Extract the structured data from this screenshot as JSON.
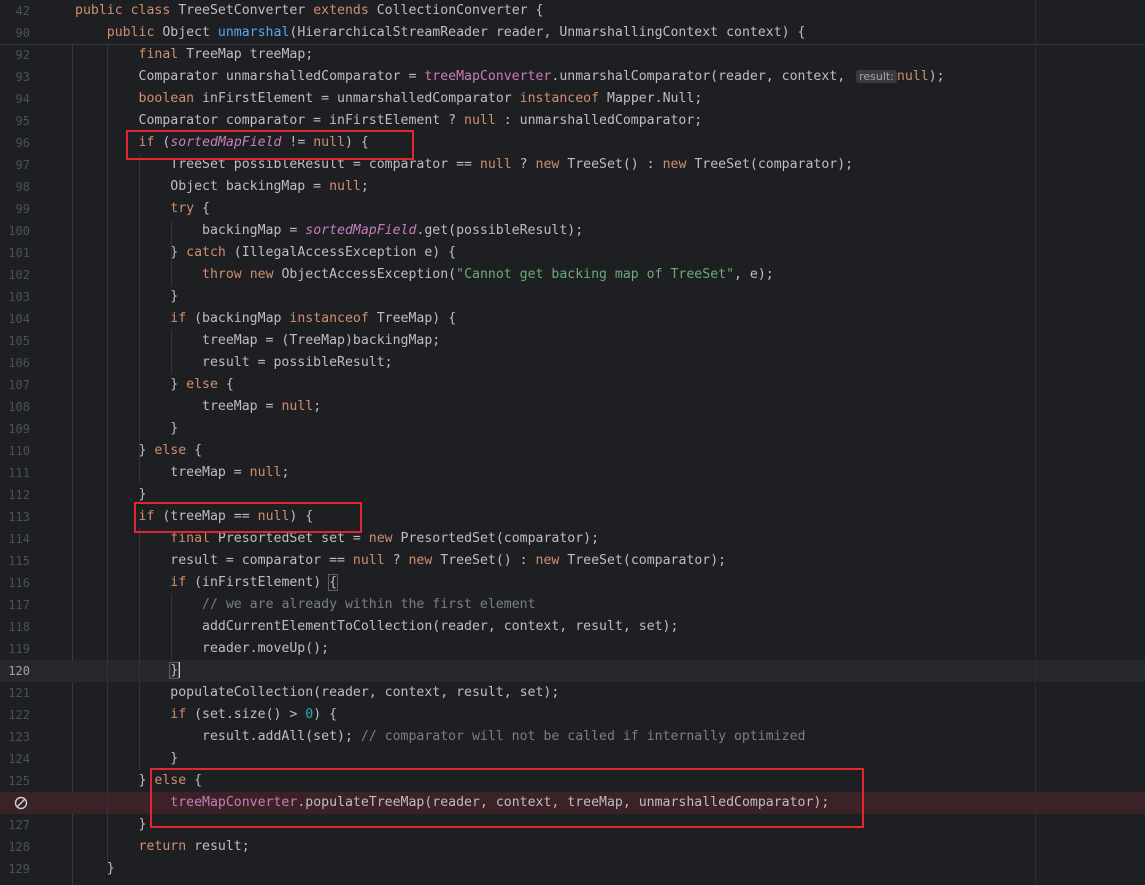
{
  "editor": {
    "sticky_lines": [
      {
        "ln": "42",
        "tokens": [
          {
            "t": "public ",
            "c": "k"
          },
          {
            "t": "class ",
            "c": "k"
          },
          {
            "t": "TreeSetConverter "
          },
          {
            "t": "extends ",
            "c": "k"
          },
          {
            "t": "CollectionConverter {"
          }
        ]
      },
      {
        "ln": "90",
        "tokens": [
          {
            "t": "    "
          },
          {
            "t": "public ",
            "c": "k"
          },
          {
            "t": "Object "
          },
          {
            "t": "unmarshal",
            "c": "fn"
          },
          {
            "t": "(HierarchicalStreamReader reader, UnmarshallingContext context) {"
          }
        ]
      }
    ],
    "lines": [
      {
        "ln": "92",
        "tokens": [
          {
            "t": "        "
          },
          {
            "t": "final ",
            "c": "k"
          },
          {
            "t": "TreeMap treeMap;"
          }
        ]
      },
      {
        "ln": "93",
        "tokens": [
          {
            "t": "        Comparator unmarshalledComparator = "
          },
          {
            "t": "treeMapConverter",
            "c": "fld"
          },
          {
            "t": ".unmarshalComparator(reader, context, "
          },
          {
            "t": "result:",
            "c": "hint"
          },
          {
            "t": "null",
            "c": "k"
          },
          {
            "t": ");"
          }
        ]
      },
      {
        "ln": "94",
        "tokens": [
          {
            "t": "        "
          },
          {
            "t": "boolean ",
            "c": "k"
          },
          {
            "t": "inFirstElement = unmarshalledComparator "
          },
          {
            "t": "instanceof ",
            "c": "k"
          },
          {
            "t": "Mapper.Null;"
          }
        ]
      },
      {
        "ln": "95",
        "tokens": [
          {
            "t": "        Comparator comparator = inFirstElement ? "
          },
          {
            "t": "null",
            "c": "k"
          },
          {
            "t": " : unmarshalledComparator;"
          }
        ]
      },
      {
        "ln": "96",
        "tokens": [
          {
            "t": "        "
          },
          {
            "t": "if ",
            "c": "k"
          },
          {
            "t": "("
          },
          {
            "t": "sortedMapField",
            "c": "fldi"
          },
          {
            "t": " != "
          },
          {
            "t": "null",
            "c": "k"
          },
          {
            "t": ") {"
          }
        ]
      },
      {
        "ln": "97",
        "tokens": [
          {
            "t": "            TreeSet possibleResult = comparator == "
          },
          {
            "t": "null",
            "c": "k"
          },
          {
            "t": " ? "
          },
          {
            "t": "new ",
            "c": "k"
          },
          {
            "t": "TreeSet() : "
          },
          {
            "t": "new ",
            "c": "k"
          },
          {
            "t": "TreeSet(comparator);"
          }
        ]
      },
      {
        "ln": "98",
        "tokens": [
          {
            "t": "            Object backingMap = "
          },
          {
            "t": "null",
            "c": "k"
          },
          {
            "t": ";"
          }
        ]
      },
      {
        "ln": "99",
        "tokens": [
          {
            "t": "            "
          },
          {
            "t": "try ",
            "c": "k"
          },
          {
            "t": "{"
          }
        ]
      },
      {
        "ln": "100",
        "tokens": [
          {
            "t": "                backingMap = "
          },
          {
            "t": "sortedMapField",
            "c": "fldi"
          },
          {
            "t": ".get(possibleResult);"
          }
        ]
      },
      {
        "ln": "101",
        "tokens": [
          {
            "t": "            } "
          },
          {
            "t": "catch ",
            "c": "k"
          },
          {
            "t": "(IllegalAccessException e) {"
          }
        ]
      },
      {
        "ln": "102",
        "tokens": [
          {
            "t": "                "
          },
          {
            "t": "throw ",
            "c": "k"
          },
          {
            "t": "new ",
            "c": "k"
          },
          {
            "t": "ObjectAccessException("
          },
          {
            "t": "\"Cannot get backing map of TreeSet\"",
            "c": "str"
          },
          {
            "t": ", e);"
          }
        ]
      },
      {
        "ln": "103",
        "tokens": [
          {
            "t": "            }"
          }
        ]
      },
      {
        "ln": "104",
        "tokens": [
          {
            "t": "            "
          },
          {
            "t": "if ",
            "c": "k"
          },
          {
            "t": "(backingMap "
          },
          {
            "t": "instanceof ",
            "c": "k"
          },
          {
            "t": "TreeMap) {"
          }
        ]
      },
      {
        "ln": "105",
        "tokens": [
          {
            "t": "                treeMap = (TreeMap)backingMap;"
          }
        ]
      },
      {
        "ln": "106",
        "tokens": [
          {
            "t": "                result = possibleResult;"
          }
        ]
      },
      {
        "ln": "107",
        "tokens": [
          {
            "t": "            } "
          },
          {
            "t": "else ",
            "c": "k"
          },
          {
            "t": "{"
          }
        ]
      },
      {
        "ln": "108",
        "tokens": [
          {
            "t": "                treeMap = "
          },
          {
            "t": "null",
            "c": "k"
          },
          {
            "t": ";"
          }
        ]
      },
      {
        "ln": "109",
        "tokens": [
          {
            "t": "            }"
          }
        ]
      },
      {
        "ln": "110",
        "tokens": [
          {
            "t": "        } "
          },
          {
            "t": "else ",
            "c": "k"
          },
          {
            "t": "{"
          }
        ]
      },
      {
        "ln": "111",
        "tokens": [
          {
            "t": "            treeMap = "
          },
          {
            "t": "null",
            "c": "k"
          },
          {
            "t": ";"
          }
        ]
      },
      {
        "ln": "112",
        "tokens": [
          {
            "t": "        }"
          }
        ]
      },
      {
        "ln": "113",
        "tokens": [
          {
            "t": "        "
          },
          {
            "t": "if ",
            "c": "k"
          },
          {
            "t": "(treeMap == "
          },
          {
            "t": "null",
            "c": "k"
          },
          {
            "t": ") {"
          }
        ]
      },
      {
        "ln": "114",
        "tokens": [
          {
            "t": "            "
          },
          {
            "t": "final ",
            "c": "k"
          },
          {
            "t": "PresortedSet set = "
          },
          {
            "t": "new ",
            "c": "k"
          },
          {
            "t": "PresortedSet(comparator);"
          }
        ]
      },
      {
        "ln": "115",
        "tokens": [
          {
            "t": "            result = comparator == "
          },
          {
            "t": "null",
            "c": "k"
          },
          {
            "t": " ? "
          },
          {
            "t": "new ",
            "c": "k"
          },
          {
            "t": "TreeSet() : "
          },
          {
            "t": "new ",
            "c": "k"
          },
          {
            "t": "TreeSet(comparator);"
          }
        ]
      },
      {
        "ln": "116",
        "tokens": [
          {
            "t": "            "
          },
          {
            "t": "if ",
            "c": "k"
          },
          {
            "t": "(inFirstElement) "
          },
          {
            "t": "{",
            "c": "bracket-hl"
          }
        ]
      },
      {
        "ln": "117",
        "tokens": [
          {
            "t": "                "
          },
          {
            "t": "// we are already within the first element",
            "c": "cm"
          }
        ]
      },
      {
        "ln": "118",
        "tokens": [
          {
            "t": "                addCurrentElementToCollection(reader, context, result, set);"
          }
        ]
      },
      {
        "ln": "119",
        "tokens": [
          {
            "t": "                reader.moveUp();"
          }
        ]
      },
      {
        "ln": "120",
        "current": true,
        "tokens": [
          {
            "t": "            "
          },
          {
            "t": "}",
            "c": "bracket-hl"
          },
          {
            "t": "",
            "c": "caret"
          }
        ]
      },
      {
        "ln": "121",
        "tokens": [
          {
            "t": "            populateCollection(reader, context, result, set);"
          }
        ]
      },
      {
        "ln": "122",
        "tokens": [
          {
            "t": "            "
          },
          {
            "t": "if ",
            "c": "k"
          },
          {
            "t": "(set.size() > "
          },
          {
            "t": "0",
            "c": "num"
          },
          {
            "t": ") {"
          }
        ]
      },
      {
        "ln": "123",
        "tokens": [
          {
            "t": "                result.addAll(set); "
          },
          {
            "t": "// comparator will not be called if internally optimized",
            "c": "cm"
          }
        ]
      },
      {
        "ln": "124",
        "tokens": [
          {
            "t": "            }"
          }
        ]
      },
      {
        "ln": "125",
        "tokens": [
          {
            "t": "        } "
          },
          {
            "t": "else ",
            "c": "k"
          },
          {
            "t": "{"
          }
        ]
      },
      {
        "ln": "",
        "breakpoint": true,
        "tokens": [
          {
            "t": "            "
          },
          {
            "t": "treeMapConverter",
            "c": "fld"
          },
          {
            "t": ".populateTreeMap(reader, context, treeMap, unmarshalledComparator);"
          }
        ]
      },
      {
        "ln": "127",
        "tokens": [
          {
            "t": "        }"
          }
        ]
      },
      {
        "ln": "128",
        "tokens": [
          {
            "t": "        "
          },
          {
            "t": "return ",
            "c": "k"
          },
          {
            "t": "result;"
          }
        ]
      },
      {
        "ln": "129",
        "tokens": [
          {
            "t": "    }"
          }
        ]
      }
    ]
  },
  "colors": {
    "background": "#1e1f22",
    "keyword": "#cf8e6d",
    "method": "#56a8f5",
    "field": "#c77dbb",
    "string": "#6aab73",
    "number": "#2aacb8",
    "comment": "#7a7e85",
    "annotation_box": "#e0262e"
  },
  "icons": {
    "breakpoint": "disabled-breakpoint-icon"
  }
}
